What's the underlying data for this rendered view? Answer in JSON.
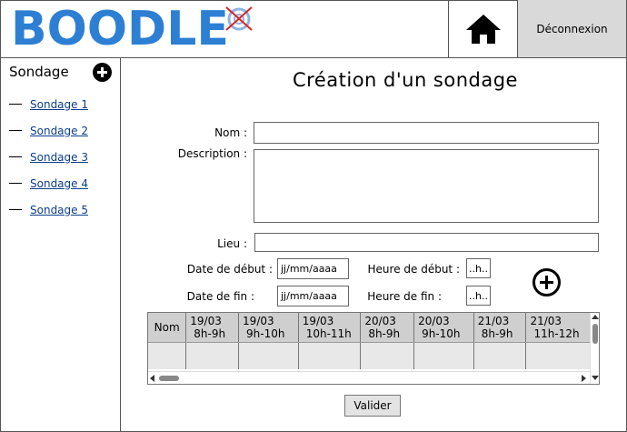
{
  "header": {
    "logo_text": "BOODLE",
    "logout_label": "Déconnexion"
  },
  "sidebar": {
    "title": "Sondage",
    "items": [
      {
        "label": "Sondage 1"
      },
      {
        "label": "Sondage 2"
      },
      {
        "label": "Sondage 3"
      },
      {
        "label": "Sondage 4"
      },
      {
        "label": "Sondage 5"
      }
    ]
  },
  "main": {
    "title": "Création d'un sondage",
    "form": {
      "nom_label": "Nom :",
      "description_label": "Description :",
      "lieu_label": "Lieu :",
      "date_debut_label": "Date de début :",
      "date_fin_label": "Date de fin :",
      "heure_debut_label": "Heure de début :",
      "heure_fin_label": "Heure de fin :",
      "date_debut_value": "jj/mm/aaaa",
      "date_fin_value": "jj/mm/aaaa",
      "heure_debut_value": "..h..",
      "heure_fin_value": "..h.."
    },
    "table": {
      "nom_header": "Nom",
      "slots": [
        {
          "date": "19/03",
          "time": "8h-9h"
        },
        {
          "date": "19/03",
          "time": "9h-10h"
        },
        {
          "date": "19/03",
          "time": "10h-11h"
        },
        {
          "date": "20/03",
          "time": "8h-9h"
        },
        {
          "date": "20/03",
          "time": "9h-10h"
        },
        {
          "date": "21/03",
          "time": "8h-9h"
        },
        {
          "date": "21/03",
          "time": "11h-12h"
        }
      ]
    },
    "submit_label": "Valider"
  },
  "icons": {
    "home": "home-icon",
    "add_survey": "plus-circle-icon",
    "add_slot": "plus-circle-outline-icon"
  },
  "colors": {
    "logo_blue": "#2d7fd3",
    "link_blue": "#0b3d8c",
    "logout_bg": "#d9d9d9",
    "header_cell_bg": "#cfcfcf"
  }
}
